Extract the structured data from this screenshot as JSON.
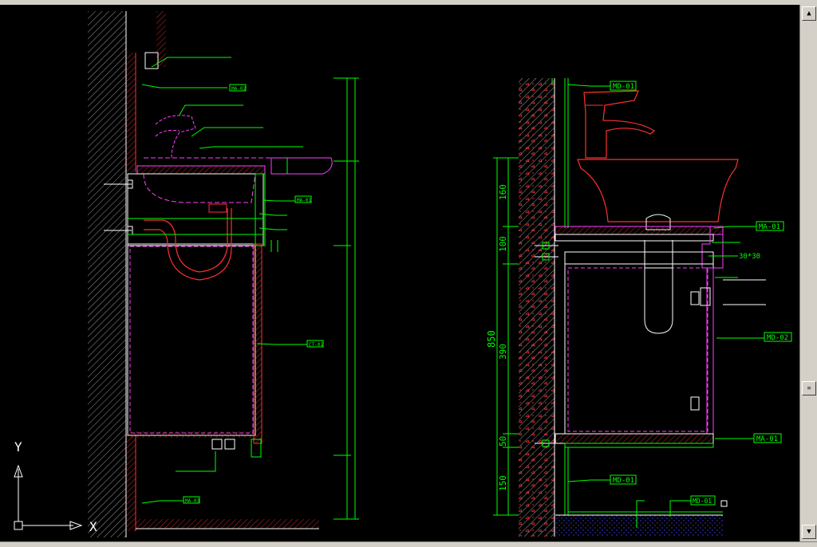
{
  "scrollbar": {
    "up_glyph": "▲",
    "down_glyph": "▼",
    "thumb_glyph": "≡"
  },
  "ucs": {
    "y_label": "Y",
    "x_label": "X"
  },
  "colors": {
    "background": "#000000",
    "dim_green": "#00ff00",
    "wall_red": "#ff3030",
    "magenta": "#ff40ff",
    "white": "#ffffff"
  },
  "left_section": {
    "labels": [
      "MA-01",
      "MA-02",
      "CT-01",
      "MA-03"
    ]
  },
  "right_section": {
    "dimensions": [
      "160",
      "100",
      "850",
      "390",
      "50",
      "150"
    ],
    "callouts": [
      "MD-01",
      "MA-01",
      "30*30",
      "MD-02",
      "MA-01",
      "MD-01",
      "MD-01"
    ]
  }
}
